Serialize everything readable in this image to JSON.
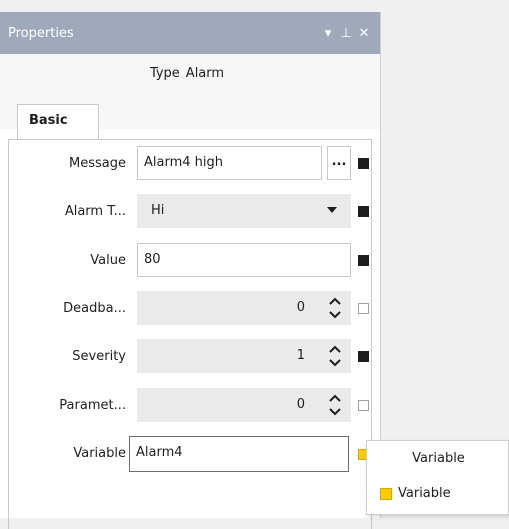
{
  "panel": {
    "title": "Properties",
    "title_buttons": {
      "dropdown": "▾",
      "pin": "⊥",
      "close": "✕"
    },
    "type_label": "Type",
    "type_value": "Alarm",
    "tab": "Basic"
  },
  "fields": {
    "message": {
      "label": "Message",
      "value": "Alarm4 high",
      "ellipsis": "..."
    },
    "alarm_type": {
      "label": "Alarm T...",
      "value": "Hi"
    },
    "value": {
      "label": "Value",
      "value": "80"
    },
    "deadband": {
      "label": "Deadba...",
      "value": "0"
    },
    "severity": {
      "label": "Severity",
      "value": "1"
    },
    "parameter": {
      "label": "Paramet...",
      "value": "0"
    },
    "variable": {
      "label": "Variable",
      "value": "Alarm4"
    }
  },
  "popup": {
    "header": "Variable",
    "item": "Variable"
  },
  "colors": {
    "titlebar": "#a0a8bc",
    "bound_marker": "#1e1e1e",
    "variable_marker": "#ffcc00"
  }
}
